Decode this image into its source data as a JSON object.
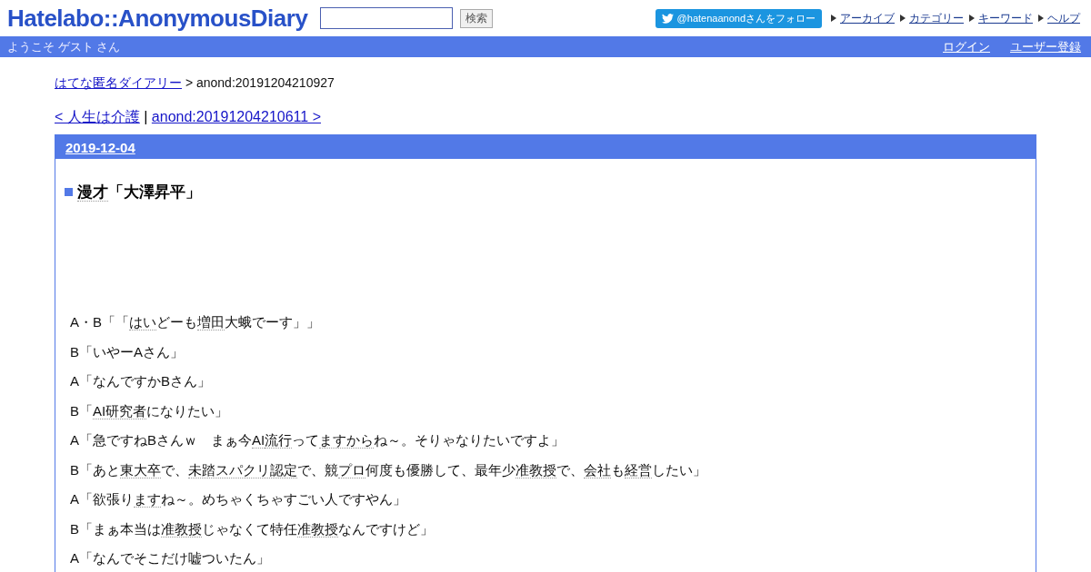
{
  "header": {
    "logo": "Hatelabo::AnonymousDiary",
    "search_button": "検索",
    "follow_button": "@hatenaanondさんをフォロー",
    "nav": [
      "アーカイブ",
      "カテゴリー",
      "キーワード",
      "ヘルプ"
    ]
  },
  "user_bar": {
    "welcome": "ようこそ ゲスト さん",
    "links": [
      "ログイン",
      "ユーザー登録"
    ]
  },
  "breadcrumb": {
    "link": "はてな匿名ダイアリー",
    "current": "> anond:20191204210927"
  },
  "pager": {
    "prev": "< 人生は介護",
    "separator": "|",
    "next": "anond:20191204210611 >"
  },
  "entry": {
    "date": "2019-12-04",
    "title": [
      {
        "text": "漫才",
        "keyword": true
      },
      {
        "text": "「大澤昇平」",
        "keyword": false
      }
    ],
    "paragraphs": [
      {
        "parts": [
          {
            "text": "A・B「「",
            "keyword": false
          },
          {
            "text": "はい",
            "keyword": true
          },
          {
            "text": "どーも",
            "keyword": false
          },
          {
            "text": "増田",
            "keyword": true
          },
          {
            "text": "大蛾でーす」」",
            "keyword": false
          }
        ]
      },
      {
        "parts": [
          {
            "text": "B「いやーAさん」",
            "keyword": false
          }
        ]
      },
      {
        "parts": [
          {
            "text": "A「なんですかBさん」",
            "keyword": false
          }
        ]
      },
      {
        "parts": [
          {
            "text": "B「",
            "keyword": false
          },
          {
            "text": "AI研究者",
            "keyword": true
          },
          {
            "text": "になりたい」",
            "keyword": false
          }
        ]
      },
      {
        "parts": [
          {
            "text": "A「急ですねBさんｗ　まぁ今",
            "keyword": false
          },
          {
            "text": "AI",
            "keyword": true
          },
          {
            "text": "流行",
            "keyword": true
          },
          {
            "text": "って",
            "keyword": false
          },
          {
            "text": "ますから",
            "keyword": true
          },
          {
            "text": "ね～。そりゃなりたいですよ」",
            "keyword": false
          }
        ]
      },
      {
        "parts": [
          {
            "text": "B「あと",
            "keyword": false
          },
          {
            "text": "東大卒",
            "keyword": true
          },
          {
            "text": "で、",
            "keyword": false
          },
          {
            "text": "未踏スパクリ認定",
            "keyword": true
          },
          {
            "text": "で、競",
            "keyword": false
          },
          {
            "text": "プロ",
            "keyword": true
          },
          {
            "text": "何度も優勝して、最年少",
            "keyword": false
          },
          {
            "text": "准教授",
            "keyword": true
          },
          {
            "text": "で、",
            "keyword": false
          },
          {
            "text": "会社",
            "keyword": true
          },
          {
            "text": "も",
            "keyword": false
          },
          {
            "text": "経営",
            "keyword": true
          },
          {
            "text": "したい」",
            "keyword": false
          }
        ]
      },
      {
        "parts": [
          {
            "text": "A「欲張り",
            "keyword": false
          },
          {
            "text": "ます",
            "keyword": true
          },
          {
            "text": "ね～。めちゃくちゃすごい人ですやん」",
            "keyword": false
          }
        ]
      },
      {
        "parts": [
          {
            "text": "B「まぁ本当は",
            "keyword": false
          },
          {
            "text": "准教授",
            "keyword": true
          },
          {
            "text": "じゃなくて特任",
            "keyword": false
          },
          {
            "text": "准教授",
            "keyword": true
          },
          {
            "text": "なんですけど」",
            "keyword": false
          }
        ]
      },
      {
        "parts": [
          {
            "text": "A「なんでそこだけ嘘ついたん」",
            "keyword": false
          }
        ]
      }
    ]
  }
}
